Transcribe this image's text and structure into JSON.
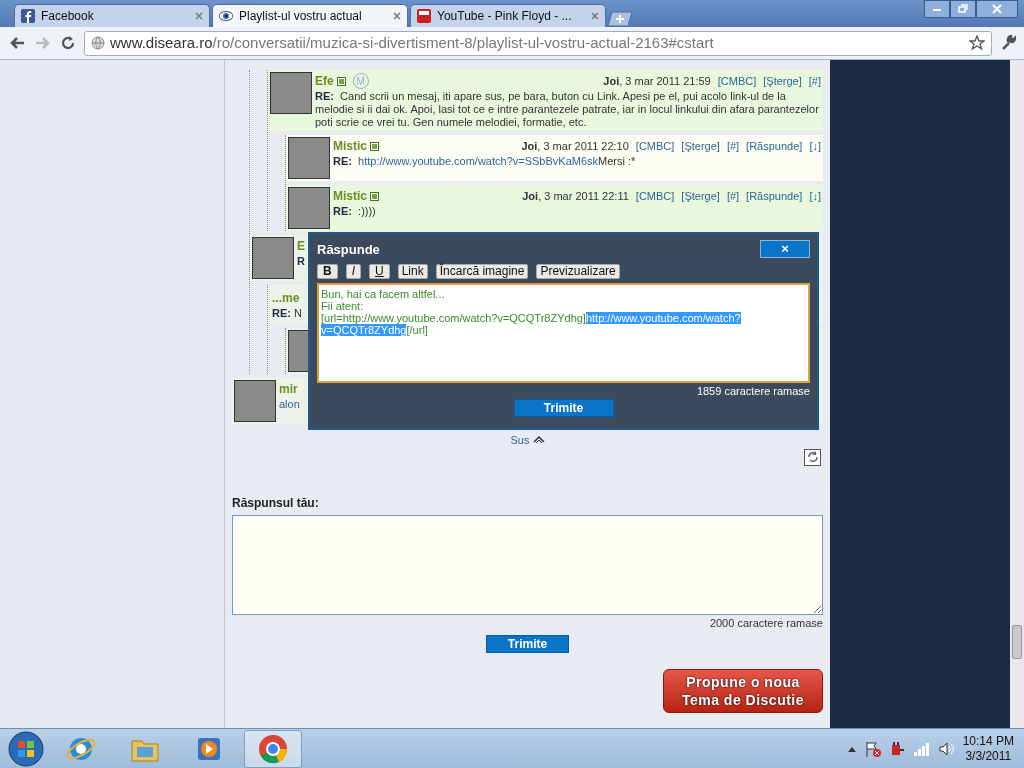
{
  "browser": {
    "tabs": [
      {
        "title": "Facebook",
        "kind": "facebook",
        "selected": false
      },
      {
        "title": "Playlist-ul vostru actual",
        "kind": "eye",
        "selected": true
      },
      {
        "title": "YouTube - Pink Floyd - ...",
        "kind": "youtube",
        "selected": false
      }
    ],
    "back": {
      "disabled": false
    },
    "forward": {
      "disabled": true
    },
    "address": {
      "host": "www.diseara.ro",
      "path": "/ro/conversatii/muzica-si-divertisment-8/playlist-ul-vostru-actual-2163#cstart"
    }
  },
  "posts": [
    {
      "kind": "scrolled",
      "children": [
        {
          "kind": "scrolled",
          "children": [
            {
              "kind": "post",
              "name": "Efe",
              "online": true,
              "badge": "M",
              "highlighted": true,
              "date": "**Joi**, 3 mar 2011 21:59",
              "actions": [
                "[CMBC]",
                "[Şterge]",
                "[#]"
              ],
              "label": "RE:",
              "body": "Cand scrii un mesaj, iti apare sus, pe bara, buton cu Link. Apesi pe el, pui acolo link-ul de la melodie si ii dai ok. Apoi, lasi tot ce e intre parantezele patrate, iar in locul linkului din afara parantezelor poti scrie ce vrei tu. Gen numele melodiei, formatie, etc.",
              "children": [
                {
                  "kind": "post",
                  "name": "Mistic",
                  "online": true,
                  "highlighted": false,
                  "date": "**Joi**, 3 mar 2011 22:10",
                  "actions": [
                    "[CMBC]",
                    "[Şterge]",
                    "[#]",
                    "[Răspunde]",
                    "[↓]"
                  ],
                  "label": "RE:",
                  "link": "http://www.youtube.com/watch?v=SSbBvKaM6sk",
                  "body": "Mersi :*"
                },
                {
                  "kind": "post",
                  "name": "Mistic",
                  "online": true,
                  "highlighted": true,
                  "date": "**Joi**, 3 mar 2011 22:11",
                  "actions": [
                    "[CMBC]",
                    "[Şterge]",
                    "[#]",
                    "[Răspunde]",
                    "[↓]"
                  ],
                  "label": "RE:",
                  "body": ":))))"
                }
              ]
            }
          ]
        },
        {
          "kind": "covered",
          "name": "E",
          "highlighted": false,
          "label": "R",
          "children": [
            {
              "kind": "covered-text",
              "name": "...me",
              "highlighted": false,
              "label": "RE:",
              "body": "N",
              "children": [
                {
                  "kind": "covered",
                  "highlighted": false
                }
              ]
            }
          ]
        }
      ]
    },
    {
      "kind": "covered",
      "name": "mir",
      "highlighted": false,
      "body": "alon"
    }
  ],
  "back_to_top": "Sus",
  "reply_form": {
    "label": "Răspunsul tău:",
    "counter": "2000 caractere ramase",
    "submit": "Trimite"
  },
  "new_topic_button": [
    "Propune o noua",
    "Tema de Discutie"
  ],
  "reply_dialog": {
    "title": "Răspunde",
    "close": "×",
    "format_buttons": [
      {
        "label": "B",
        "kind": "bold"
      },
      {
        "label": "I",
        "kind": "italic"
      },
      {
        "label": "U",
        "kind": "underline"
      },
      {
        "label": "Link",
        "kind": "plain"
      },
      {
        "label": "Încarcă imagine",
        "kind": "plain"
      },
      {
        "label": "Previzualizare",
        "kind": "plain"
      }
    ],
    "message_lines": [
      [
        {
          "text": "Bun, hai ca facem altfel...",
          "selected": false
        }
      ],
      [
        {
          "text": "Fii atent:",
          "selected": false
        }
      ],
      [
        {
          "text": "[url=http://www.youtube.com/watch?v=QCQTr8ZYdhg]",
          "selected": false
        },
        {
          "text": "http://www.youtube.com/watch?v=QCQTr8ZYdhg",
          "selected": true
        },
        {
          "text": "[/url]",
          "selected": false
        }
      ]
    ],
    "counter": "1859 caractere ramase",
    "submit": "Trimite"
  },
  "taskbar": {
    "apps": [
      {
        "kind": "ie",
        "active": false
      },
      {
        "kind": "folder",
        "active": false
      },
      {
        "kind": "media",
        "active": false
      },
      {
        "kind": "chrome",
        "active": true
      }
    ],
    "time": "10:14 PM",
    "date": "3/3/2011"
  }
}
